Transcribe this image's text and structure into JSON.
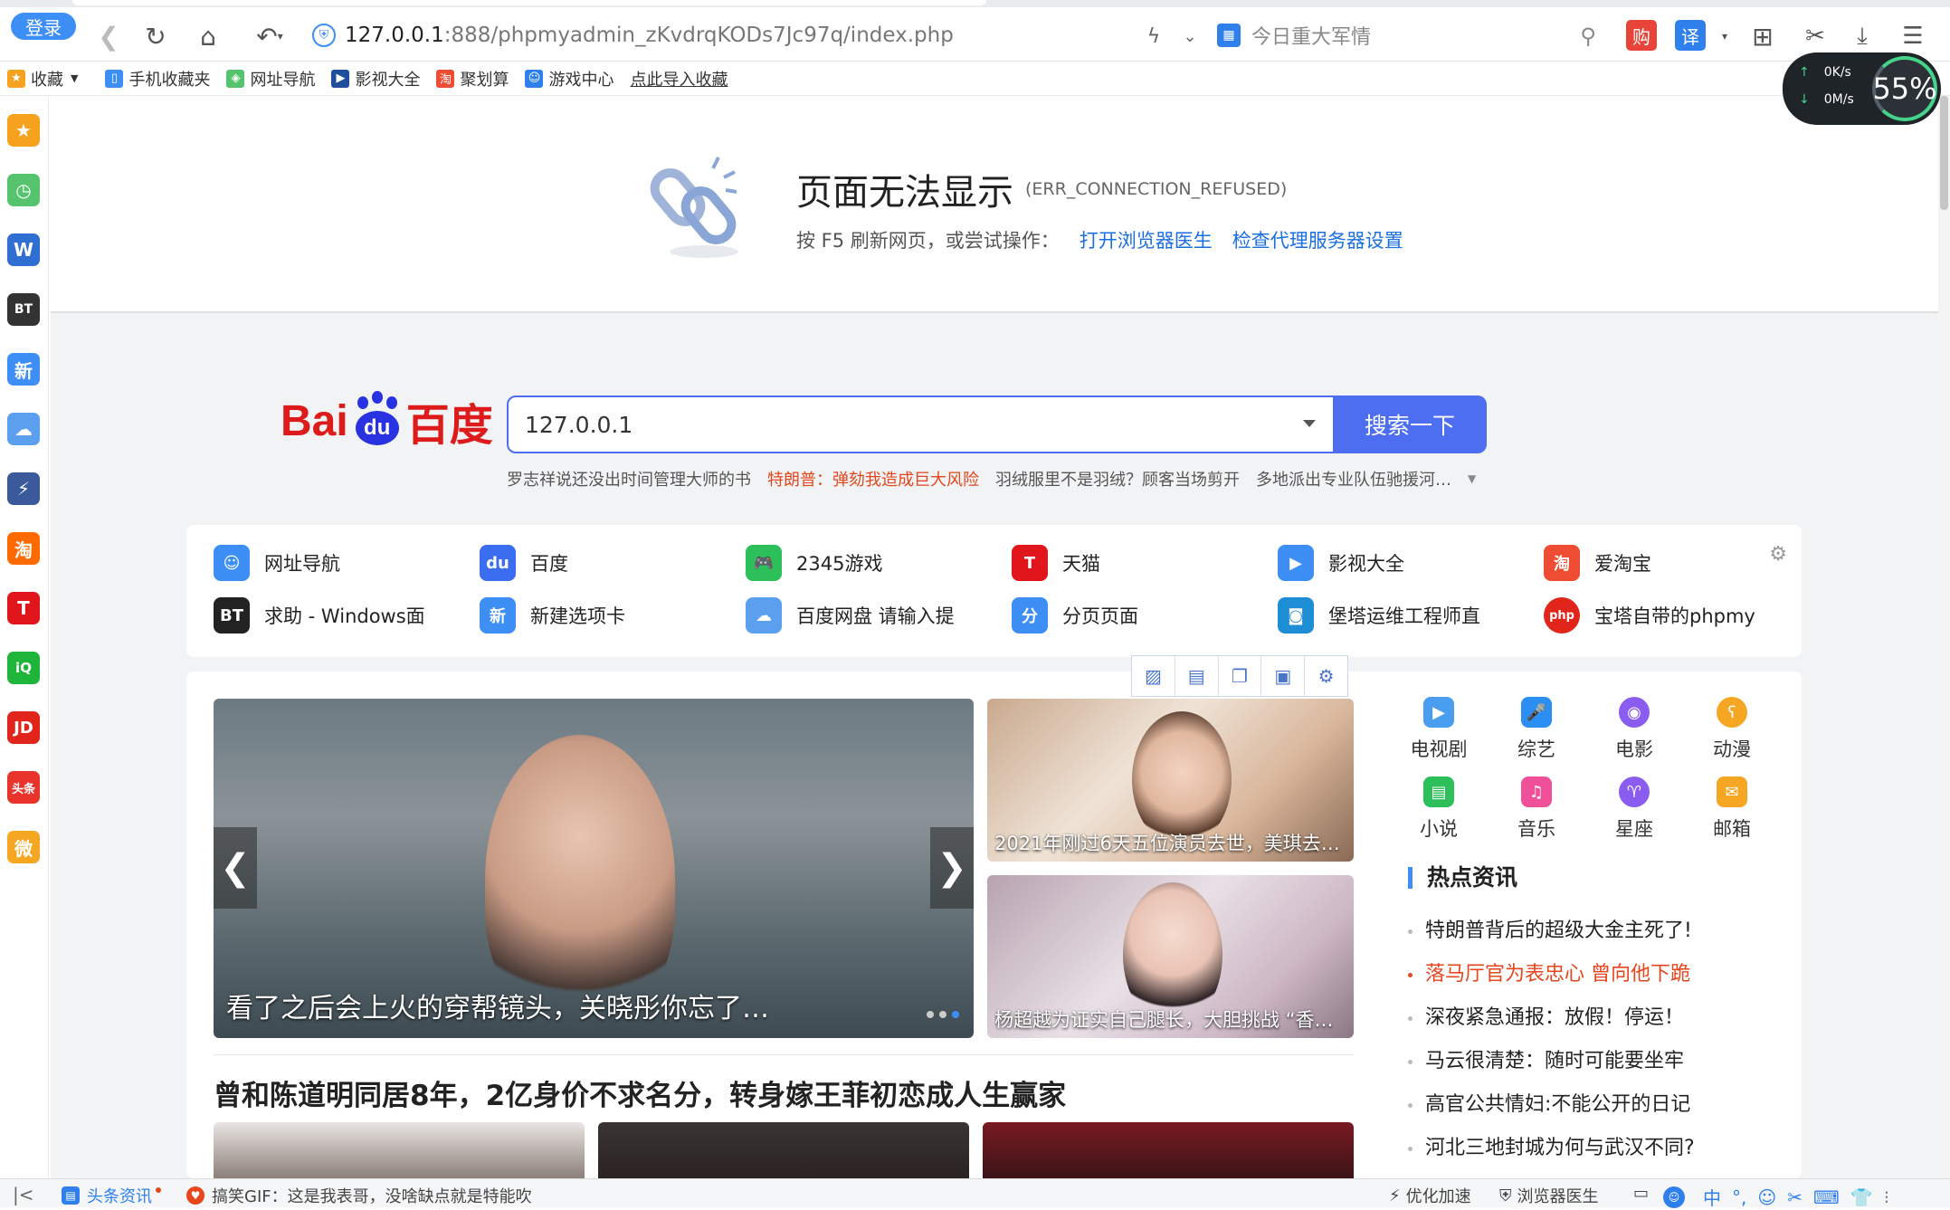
{
  "browser": {
    "login_label": "登录",
    "url_host": "127.0.0.1",
    "url_rest": ":888/phpmyadmin_zKvdrqKODs7Jc97q/index.php",
    "hot_news_text": "今日重大军情",
    "shop_label": "购",
    "translate_label": "译"
  },
  "bookmarks": [
    {
      "label": "收藏",
      "icon": "star-icon"
    },
    {
      "label": "手机收藏夹",
      "icon": "phone-icon"
    },
    {
      "label": "网址导航",
      "icon": "nav-icon"
    },
    {
      "label": "影视大全",
      "icon": "film-icon"
    },
    {
      "label": "聚划算",
      "icon": "taobao-icon"
    },
    {
      "label": "游戏中心",
      "icon": "game-icon"
    },
    {
      "label": "点此导入收藏",
      "icon": ""
    }
  ],
  "speed": {
    "up": "0K/s",
    "down": "0M/s",
    "percent": "55%"
  },
  "sidebar": [
    {
      "name": "favorites",
      "text": "★",
      "color": "#f6a21e"
    },
    {
      "name": "history",
      "text": "◷",
      "color": "#56c36e"
    },
    {
      "name": "word",
      "text": "W",
      "color": "#2f6fd1"
    },
    {
      "name": "bt",
      "text": "BT",
      "color": "#333333"
    },
    {
      "name": "new",
      "text": "新",
      "color": "#3d8ef5"
    },
    {
      "name": "cloud",
      "text": "☁",
      "color": "#5aa0ee"
    },
    {
      "name": "app",
      "text": "⚡",
      "color": "#3a5a9b"
    },
    {
      "name": "taobao",
      "text": "淘",
      "color": "#ff6a00"
    },
    {
      "name": "tmall",
      "text": "T",
      "color": "#e1161c"
    },
    {
      "name": "iqiyi",
      "text": "iQ",
      "color": "#1fb53a"
    },
    {
      "name": "jd",
      "text": "JD",
      "color": "#e1251b"
    },
    {
      "name": "toutiao",
      "text": "头条",
      "color": "#e9342c"
    },
    {
      "name": "weibo",
      "text": "微",
      "color": "#f5a623"
    }
  ],
  "error": {
    "title": "页面无法显示",
    "code": "(ERR_CONNECTION_REFUSED)",
    "hint": "按 F5 刷新网页，或尝试操作：",
    "link1": "打开浏览器医生",
    "link2": "检查代理服务器设置"
  },
  "baidu": {
    "logo_text": "Bai",
    "logo_du": "du",
    "logo_cn": "百度",
    "query": "127.0.0.1",
    "button": "搜索一下",
    "hot": [
      {
        "text": "罗志祥说还没出时间管理大师的书",
        "red": false
      },
      {
        "text": "特朗普：弹劾我造成巨大风险",
        "red": true
      },
      {
        "text": "羽绒服里不是羽绒？顾客当场剪开",
        "red": false
      },
      {
        "text": "多地派出专业队伍驰援河…",
        "red": false
      }
    ]
  },
  "quick_links": [
    {
      "label": "网址导航",
      "text": "☺",
      "color": "#3d8ef5"
    },
    {
      "label": "百度",
      "text": "du",
      "color": "#3a6df0"
    },
    {
      "label": "2345游戏",
      "text": "🎮",
      "color": "#2cbf5a"
    },
    {
      "label": "天猫",
      "text": "T",
      "color": "#e1161c"
    },
    {
      "label": "影视大全",
      "text": "▶",
      "color": "#3d8ef5"
    },
    {
      "label": "爱淘宝",
      "text": "淘",
      "color": "#ef4d33"
    },
    {
      "label": "求助 - Windows面",
      "text": "BT",
      "color": "#222222"
    },
    {
      "label": "新建选项卡",
      "text": "新",
      "color": "#3d8ef5"
    },
    {
      "label": "百度网盘 请输入提",
      "text": "☁",
      "color": "#5aa0ee"
    },
    {
      "label": "分页页面",
      "text": "分",
      "color": "#3d8ef5"
    },
    {
      "label": "堡塔运维工程师直",
      "text": "◙",
      "color": "#1e8ed6"
    },
    {
      "label": "宝塔自带的phpmy",
      "text": "php",
      "color": "#e1251b"
    }
  ],
  "news": {
    "main_caption": "看了之后会上火的穿帮镜头，关晓彤你忘了…",
    "side1_caption": "2021年刚过6天五位演员去世，美琪去…",
    "side2_caption": "杨超越为证实自己腿长，大胆挑战 “香…",
    "headline": "曾和陈道明同居8年，2亿身价不求名分，转身嫁王菲初恋成人生赢家"
  },
  "categories": [
    {
      "label": "电视剧",
      "text": "▶",
      "color": "#4a9ef0"
    },
    {
      "label": "综艺",
      "text": "🎤",
      "color": "#2b8ef3"
    },
    {
      "label": "电影",
      "text": "◉",
      "color": "#8b5cf0"
    },
    {
      "label": "动漫",
      "text": "ʕ",
      "color": "#f5a623"
    },
    {
      "label": "小说",
      "text": "▤",
      "color": "#2cbf5a"
    },
    {
      "label": "音乐",
      "text": "♫",
      "color": "#f04f9a"
    },
    {
      "label": "星座",
      "text": "♈",
      "color": "#8b5cf0"
    },
    {
      "label": "邮箱",
      "text": "✉",
      "color": "#f5a623"
    }
  ],
  "hot_info": {
    "title": "热点资讯",
    "items": [
      {
        "text": "特朗普背后的超级大金主死了!",
        "red": false
      },
      {
        "text": "落马厅官为表忠心 曾向他下跪",
        "red": true
      },
      {
        "text": "深夜紧急通报：放假！停运！",
        "red": false
      },
      {
        "text": "马云很清楚：随时可能要坐牢",
        "red": false
      },
      {
        "text": "高官公共情妇:不能公开的日记",
        "red": false
      },
      {
        "text": "河北三地封城为何与武汉不同?",
        "red": false
      }
    ]
  },
  "status": {
    "news_label": "头条资讯",
    "gif_text": "搞笑GIF：这是我表哥，没啥缺点就是特能吹",
    "speedup": "优化加速",
    "doctor": "浏览器医生",
    "ime": "中"
  },
  "colors": {
    "accent": "#3d8ef5",
    "baidu_blue": "#4e6ef2",
    "baidu_red": "#de1b1b",
    "link": "#1a6fe0",
    "hot_red": "#e5461c"
  }
}
